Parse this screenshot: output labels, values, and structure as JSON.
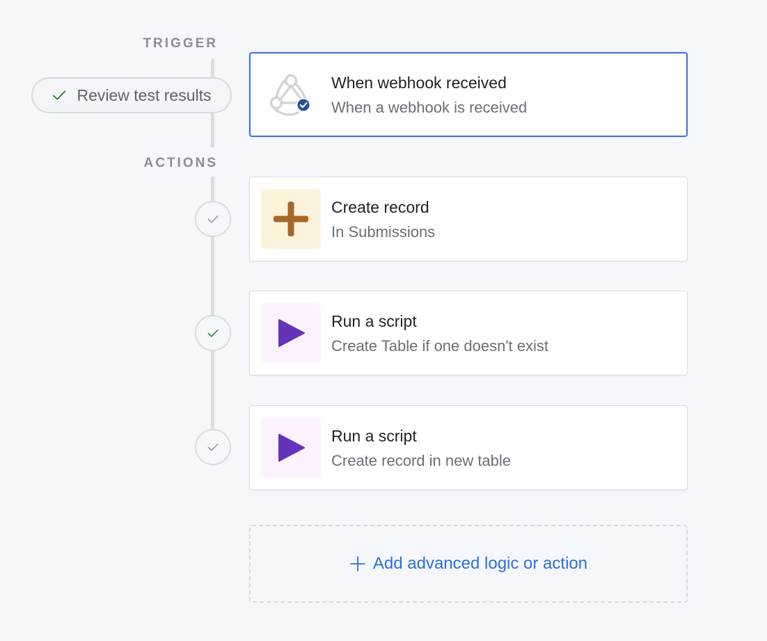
{
  "trigger_label": "TRIGGER",
  "actions_label": "ACTIONS",
  "review_button": {
    "label": "Review test results",
    "icon": "check-icon"
  },
  "trigger_card": {
    "title": "When webhook received",
    "subtitle": "When a webhook is received",
    "icon": "webhook-icon"
  },
  "actions": [
    {
      "title": "Create record",
      "subtitle": "In Submissions",
      "icon": "plus-icon",
      "icon_color": "#a7672a",
      "icon_bg": "#fdf3dc",
      "check_color": "#8f9298"
    },
    {
      "title": "Run a script",
      "subtitle": "Create Table if one doesn't exist",
      "icon": "play-icon",
      "icon_color": "#6433b7",
      "icon_bg": "#fbf2fd",
      "check_color": "#2f7d3a"
    },
    {
      "title": "Run a script",
      "subtitle": "Create record in new table",
      "icon": "play-icon",
      "icon_color": "#6433b7",
      "icon_bg": "#fbf2fd",
      "check_color": "#8f9298"
    }
  ],
  "add_action": {
    "label": "Add advanced logic or action",
    "icon": "plus-icon"
  },
  "colors": {
    "accent": "#2d6fd6",
    "selected_border": "#3f73d9",
    "success": "#2f7d3a"
  }
}
